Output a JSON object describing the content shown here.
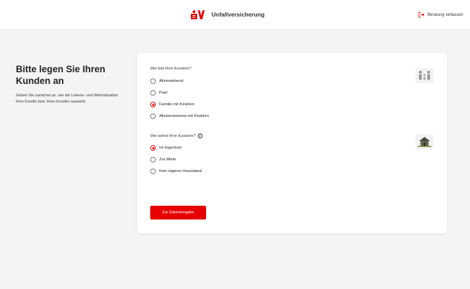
{
  "header": {
    "app_title": "Unfallversicherung",
    "exit_label": "Beratung verlassen",
    "brand_color": "#e60000"
  },
  "intro": {
    "heading": "Bitte legen Sie Ihren Kunden an",
    "text": "Geben Sie zunächst an, wie die Lebens- und Wohnsituation Ihrer Kundin bzw. Ihres Kunden aussieht."
  },
  "form": {
    "household": {
      "question": "Wie lebt Ihr/e Kunde/in?",
      "options": [
        {
          "label": "Alleinstehend",
          "selected": false
        },
        {
          "label": "Paar",
          "selected": false
        },
        {
          "label": "Familie mit Kind/ern",
          "selected": true
        },
        {
          "label": "Alleinerziehend mit Kind/ern",
          "selected": false
        }
      ],
      "illustration": "family-icon"
    },
    "housing": {
      "question": "Wie wohnt Ihr/e Kunde/in?",
      "info": "i",
      "options": [
        {
          "label": "Im Eigentum",
          "selected": true
        },
        {
          "label": "Zur Miete",
          "selected": false
        },
        {
          "label": "Kein eigener Hausstand",
          "selected": false
        }
      ],
      "illustration": "house-icon"
    },
    "submit_label": "Zur Dateneingabe"
  }
}
